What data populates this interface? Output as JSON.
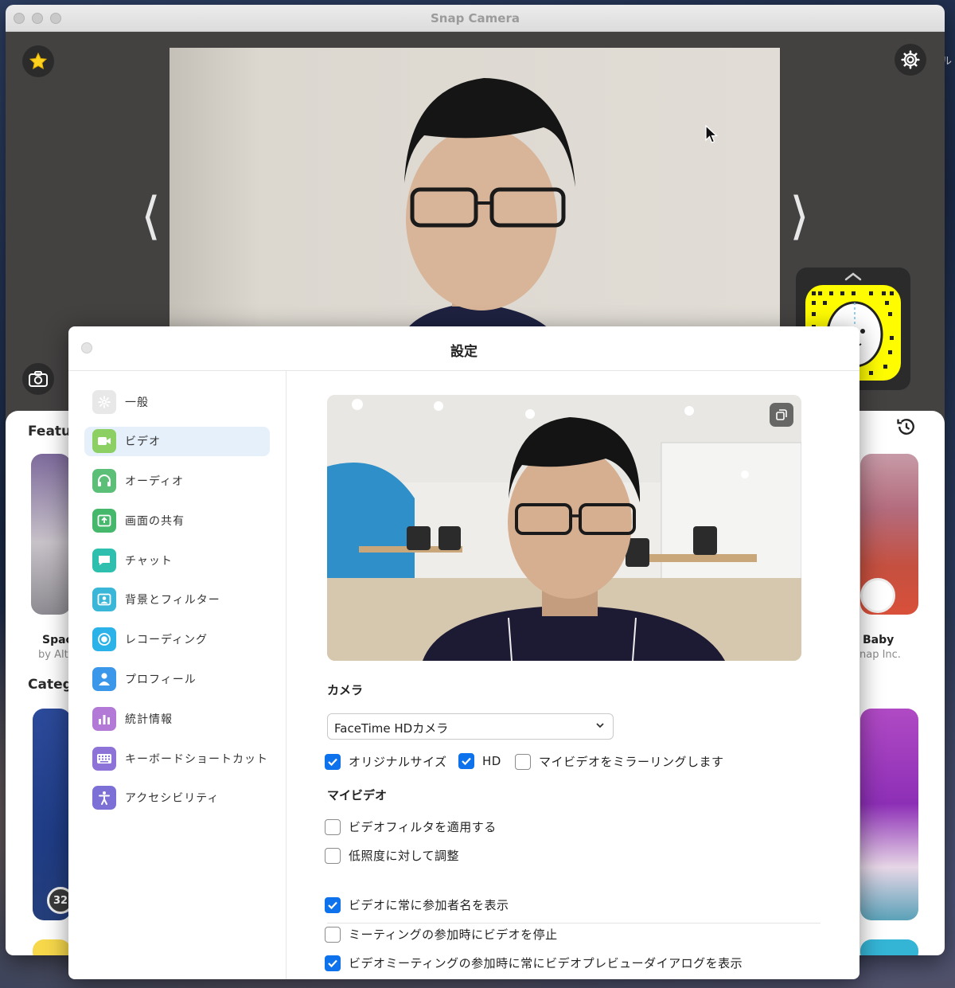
{
  "snap_window": {
    "title": "Snap Camera",
    "edge_text": "ル",
    "drawer": {
      "featured_label": "Featu",
      "category_label": "Categ",
      "lens_left_name": "Spac",
      "lens_left_author": "by Alt",
      "lens_right_name": "Baby",
      "lens_right_author": "nap Inc.",
      "lens_badge": "32"
    }
  },
  "settings": {
    "title": "設定",
    "sidebar": {
      "items": [
        {
          "label": "一般",
          "icon": "gear-icon",
          "color": "#e8e8e8"
        },
        {
          "label": "ビデオ",
          "icon": "video-camera-icon",
          "color": "#8ccf63",
          "active": true
        },
        {
          "label": "オーディオ",
          "icon": "headphones-icon",
          "color": "#5cbf78"
        },
        {
          "label": "画面の共有",
          "icon": "share-screen-icon",
          "color": "#45b86b"
        },
        {
          "label": "チャット",
          "icon": "chat-icon",
          "color": "#2fbfae"
        },
        {
          "label": "背景とフィルター",
          "icon": "background-icon",
          "color": "#3ab7d8"
        },
        {
          "label": "レコーディング",
          "icon": "record-icon",
          "color": "#2bb2e8"
        },
        {
          "label": "プロフィール",
          "icon": "profile-icon",
          "color": "#3b97ea"
        },
        {
          "label": "統計情報",
          "icon": "statistics-icon",
          "color": "#b27ad6"
        },
        {
          "label": "キーボードショートカット",
          "icon": "keyboard-icon",
          "color": "#8d73d8"
        },
        {
          "label": "アクセシビリティ",
          "icon": "accessibility-icon",
          "color": "#7c70d6"
        }
      ]
    },
    "video": {
      "camera_section": "カメラ",
      "camera_select": "FaceTime HDカメラ",
      "checks_row": [
        {
          "label": "オリジナルサイズ",
          "checked": true
        },
        {
          "label": "HD",
          "checked": true
        },
        {
          "label": "マイビデオをミラーリングします",
          "checked": false
        }
      ],
      "my_video_section": "マイビデオ",
      "my_video_checks": [
        {
          "label": "ビデオフィルタを適用する",
          "checked": false
        },
        {
          "label": "低照度に対して調整",
          "checked": false
        }
      ],
      "more_checks": [
        {
          "label": "ビデオに常に参加者名を表示",
          "checked": true
        },
        {
          "label": "ミーティングの参加時にビデオを停止",
          "checked": false
        },
        {
          "label": "ビデオミーティングの参加時に常にビデオプレビューダイアログを表示",
          "checked": true
        }
      ]
    }
  }
}
